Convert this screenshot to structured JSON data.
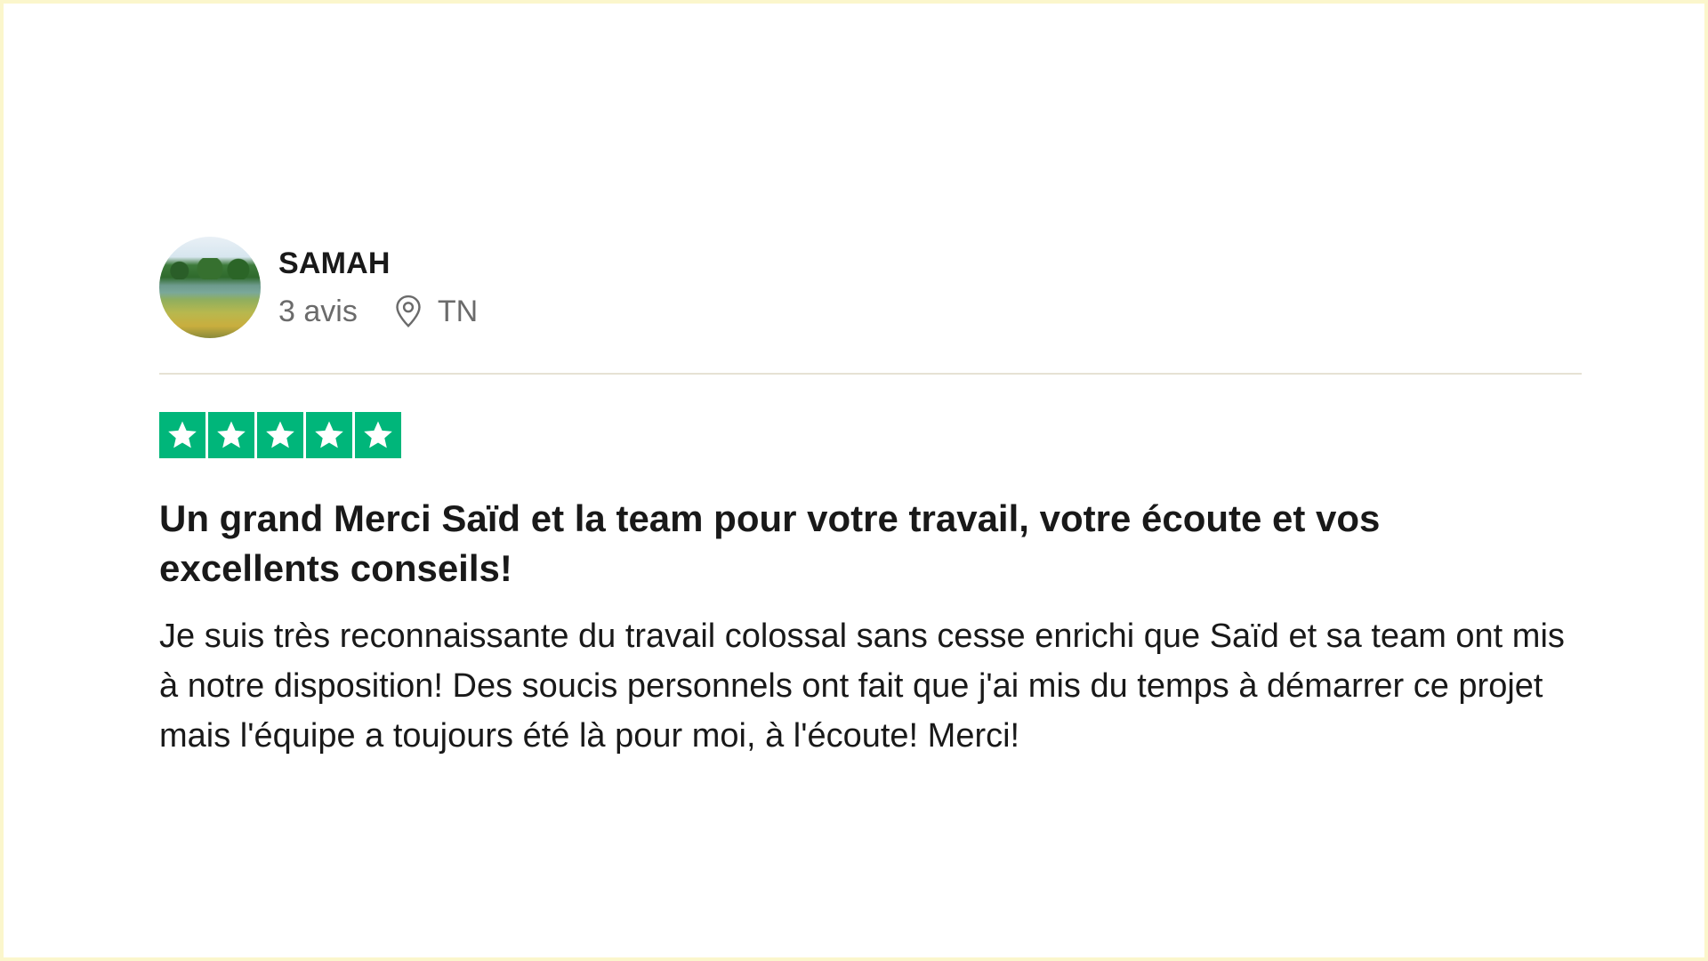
{
  "reviewer": {
    "name": "SAMAH",
    "review_count": "3 avis",
    "location": "TN",
    "avatar_icon": "landscape-avatar"
  },
  "rating": {
    "stars": 5,
    "max": 5,
    "star_color": "#00b67a"
  },
  "review": {
    "title": "Un grand Merci Saïd et la team pour votre travail, votre écoute et vos excellents conseils!",
    "body": "Je suis très reconnaissante du travail colossal sans cesse enrichi que Saïd et sa team ont mis à notre disposition! Des soucis personnels ont fait que j'ai mis du temps à démarrer ce projet mais l'équipe a toujours été là pour moi, à l'écoute! Merci!"
  },
  "colors": {
    "frame_border": "#fbf6cc",
    "divider": "#e6e2d4",
    "meta_text": "#6b6b6b"
  }
}
